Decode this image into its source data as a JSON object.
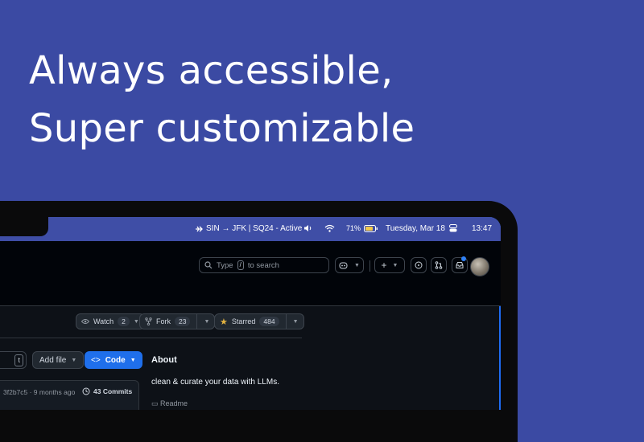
{
  "headline": {
    "line1": "Always accessible,",
    "line2": "Super customizable"
  },
  "menubar": {
    "flight_status": "SIN → JFK | SQ24 - Active",
    "battery": "71%",
    "date": "Tuesday, Mar 18",
    "time": "13:47",
    "icons": [
      "airplane-icon",
      "speaker-icon",
      "wifi-icon",
      "battery-icon",
      "control-center-icon"
    ]
  },
  "github": {
    "search_prefix": "Type",
    "search_key": "/",
    "search_suffix": "to search",
    "watch": {
      "label": "Watch",
      "count": "2"
    },
    "fork": {
      "label": "Fork",
      "count": "23"
    },
    "star": {
      "label": "Starred",
      "count": "484"
    },
    "go_to_file_key": "t",
    "add_file": "Add file",
    "code": "Code",
    "about_title": "About",
    "about_description": "clean & curate your data with LLMs.",
    "readme": "Readme",
    "commit_meta": "3f2b7c5 · 9 months ago",
    "commits_count": "43 Commits"
  },
  "colors": {
    "background": "#3b4aa3",
    "menubar": "#3f4ea6",
    "code_button": "#1f6feb",
    "star_icon": "#e3b341"
  }
}
